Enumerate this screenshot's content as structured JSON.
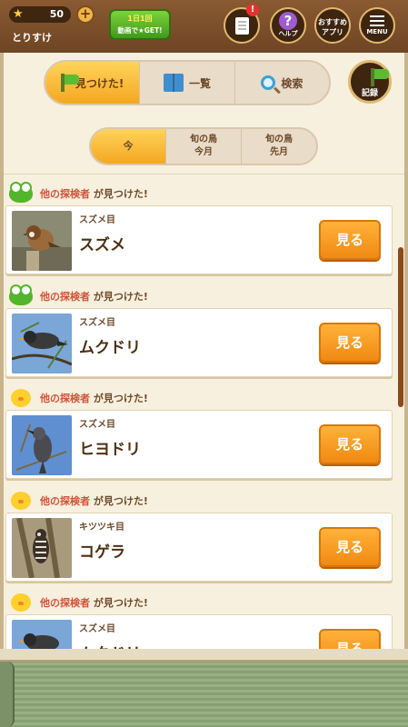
{
  "header": {
    "star_count": "50",
    "plus_label": "+",
    "username": "とりすけ",
    "video_line1": "1日1回",
    "video_line2": "動画で★GET!",
    "notification_badge": "!",
    "help_label": "ヘルプ",
    "recommend_line1": "おすすめ",
    "recommend_line2": "アプリ",
    "menu_label": "MENU"
  },
  "main_tabs": [
    {
      "label": "見つけた!",
      "icon": "flag-icon",
      "active": true
    },
    {
      "label": "一覧",
      "icon": "book-icon",
      "active": false
    },
    {
      "label": "検索",
      "icon": "magnifier-icon",
      "active": false
    }
  ],
  "record_label": "記録",
  "period_tabs": [
    {
      "line1": "今",
      "line2": "",
      "active": true
    },
    {
      "line1": "旬の鳥",
      "line2": "今月",
      "active": false
    },
    {
      "line1": "旬の鳥",
      "line2": "先月",
      "active": false
    }
  ],
  "feed": {
    "finder_label": "他の探検者",
    "found_label": "が見つけた!",
    "see_button_label": "見る",
    "items": [
      {
        "avatar": "frog-icon",
        "order": "スズメ目",
        "name": "スズメ"
      },
      {
        "avatar": "frog-icon",
        "order": "スズメ目",
        "name": "ムクドリ"
      },
      {
        "avatar": "chick-icon",
        "order": "スズメ目",
        "name": "ヒヨドリ"
      },
      {
        "avatar": "chick-icon",
        "order": "キツツキ目",
        "name": "コゲラ"
      },
      {
        "avatar": "chick-icon",
        "order": "スズメ目",
        "name": "ムクドリ"
      }
    ]
  },
  "colors": {
    "accent_orange": "#f4a722",
    "button_orange": "#f08a12",
    "finder_red": "#d4513a",
    "wood_brown": "#6e4523"
  }
}
